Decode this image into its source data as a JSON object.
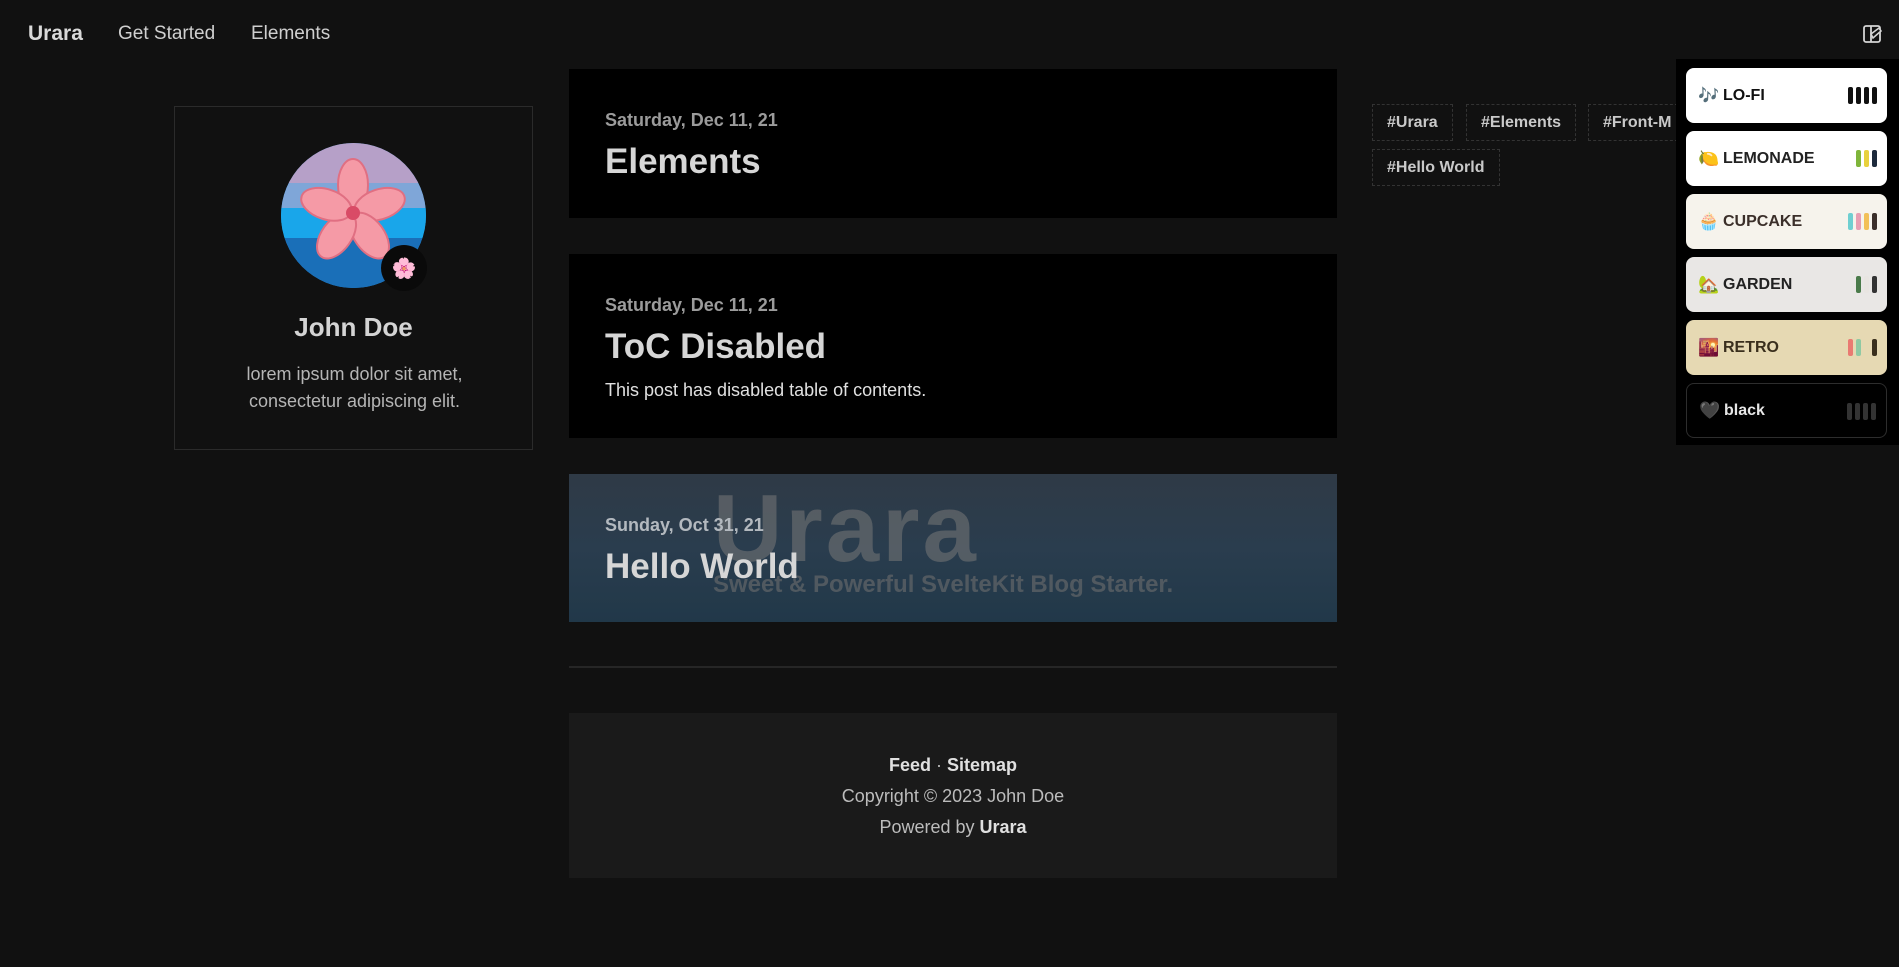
{
  "nav": {
    "brand": "Urara",
    "links": [
      "Get Started",
      "Elements"
    ]
  },
  "profile": {
    "name": "John Doe",
    "bio_line1": "lorem ipsum dolor sit amet,",
    "bio_line2": "consectetur adipiscing elit.",
    "badge_emoji": "🌸"
  },
  "posts": [
    {
      "date": "Saturday, Dec 11, 21",
      "title": "Elements"
    },
    {
      "date": "Saturday, Dec 11, 21",
      "title": "ToC Disabled",
      "description": "This post has disabled table of contents."
    },
    {
      "date": "Sunday, Oct 31, 21",
      "title": "Hello World",
      "cover_title": "Urara",
      "cover_subtitle": "Sweet & Powerful SvelteKit Blog Starter."
    }
  ],
  "footer": {
    "feed": "Feed",
    "sep": " · ",
    "sitemap": "Sitemap",
    "copyright": "Copyright © 2023 John Doe",
    "powered_prefix": "Powered by ",
    "powered_name": "Urara"
  },
  "tags": [
    "#Urara",
    "#Elements",
    "#Front-M",
    "#Hello World"
  ],
  "themes": [
    {
      "emoji": "🎶",
      "label": "LO-FI",
      "swatches": [
        "#111111",
        "#111111",
        "#111111",
        "#111111"
      ]
    },
    {
      "emoji": "🍋",
      "label": "LEMONADE",
      "swatches": [
        "#7fb53a",
        "#e8d13d",
        "#1d2a3c"
      ]
    },
    {
      "emoji": "🧁",
      "label": "CUPCAKE",
      "swatches": [
        "#6fcfd1",
        "#e79fb3",
        "#f2c058",
        "#3b2f2a"
      ]
    },
    {
      "emoji": "🏡",
      "label": "GARDEN",
      "swatches": [
        "#4a7a4a",
        "#e8e5e1",
        "#333333"
      ]
    },
    {
      "emoji": "🌇",
      "label": "RETRO",
      "swatches": [
        "#e97a72",
        "#8fc9a3",
        "#e6d9b3",
        "#3a2f1d"
      ]
    },
    {
      "emoji": "🖤",
      "label": "black",
      "swatches": [
        "#333333",
        "#333333",
        "#333333",
        "#333333"
      ]
    }
  ]
}
